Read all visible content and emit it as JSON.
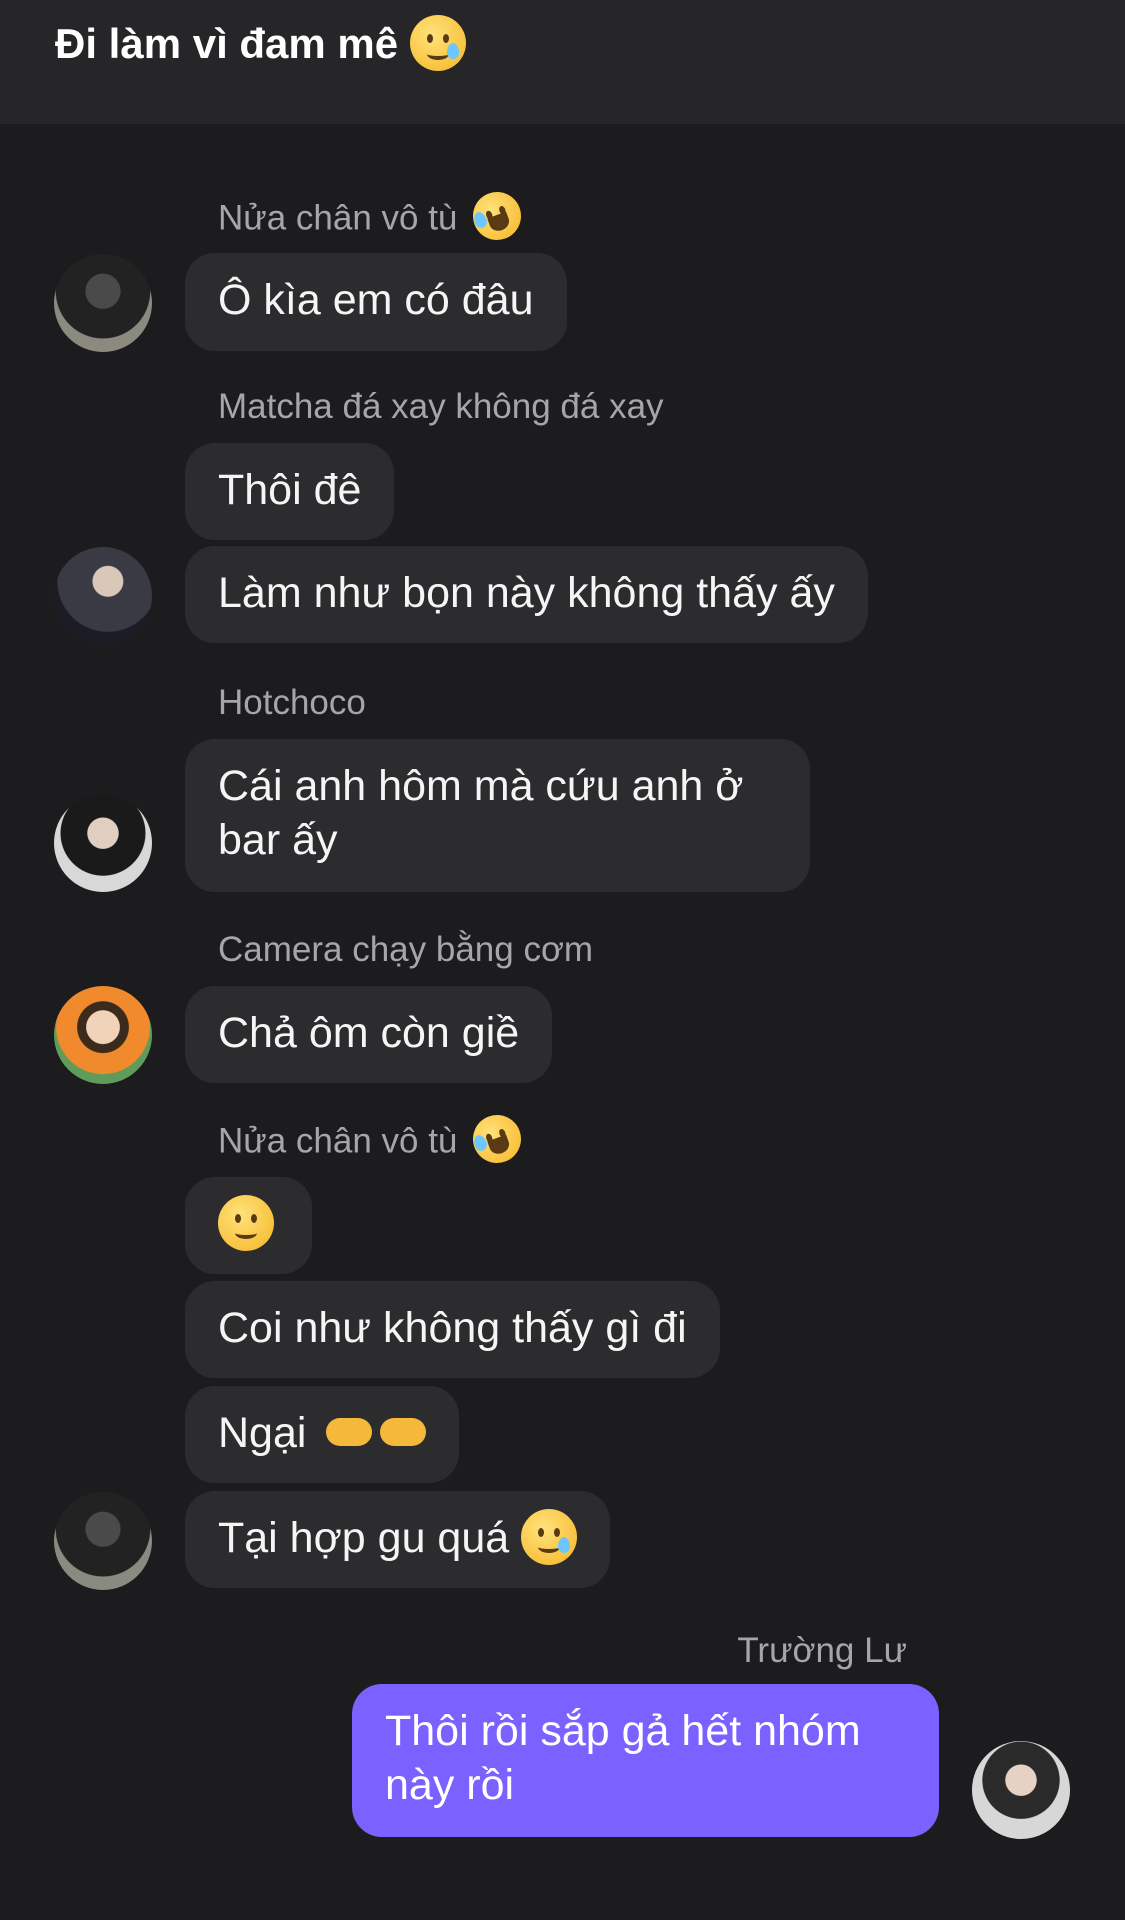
{
  "header": {
    "title": "Đi làm vì đam mê"
  },
  "messages": {
    "m1": {
      "sender": "Nửa chân vô tù",
      "text": "Ô kìa em có đâu"
    },
    "m2": {
      "sender": "Matcha đá xay không đá xay",
      "text1": "Thôi đê",
      "text2": "Làm như bọn này không thấy ấy"
    },
    "m3": {
      "sender": "Hotchoco",
      "text": "Cái anh hôm mà cứu anh ở bar ấy"
    },
    "m4": {
      "sender": "Camera chạy bằng cơm",
      "text": "Chả ôm còn giề"
    },
    "m5": {
      "sender": "Nửa chân vô tù",
      "text2": "Coi như không thấy gì đi",
      "text3": "Ngại",
      "text4": "Tại hợp gu quá"
    },
    "m6": {
      "sender": "Trường Lư",
      "text": "Thôi rồi sắp gả hết nhóm này rồi"
    }
  },
  "icons": [
    "face-holding-back-tears-icon",
    "rolling-on-floor-laughing-icon",
    "slightly-smiling-face-icon",
    "index-pointing-hands-icon"
  ],
  "colors": {
    "background": "#1c1c1e",
    "header": "#262628",
    "bubble": "#2c2c2e",
    "my_bubble": "#7b61ff",
    "sender_name": "#a5a5aa"
  }
}
